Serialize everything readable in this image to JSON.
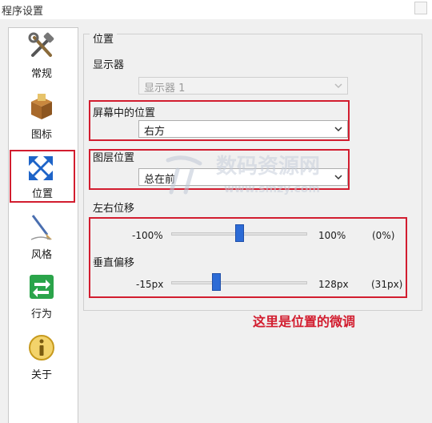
{
  "window": {
    "title": "程序设置"
  },
  "sidebar": {
    "items": [
      {
        "label": "常规",
        "icon": "tools-icon"
      },
      {
        "label": "图标",
        "icon": "package-icon"
      },
      {
        "label": "位置",
        "icon": "move-arrows-icon",
        "selected": true
      },
      {
        "label": "风格",
        "icon": "brush-icon"
      },
      {
        "label": "行为",
        "icon": "exchange-arrows-icon"
      },
      {
        "label": "关于",
        "icon": "info-icon"
      }
    ]
  },
  "position_group": {
    "title": "位置",
    "monitor_label": "显示器",
    "monitor_value": "显示器 1",
    "screen_position_label": "屏幕中的位置",
    "screen_position_value": "右方",
    "layer_label": "图层位置",
    "layer_value": "总在前",
    "horizontal": {
      "label": "左右位移",
      "min": "-100%",
      "max": "100%",
      "current": "(0%)",
      "fraction": 0.5
    },
    "vertical": {
      "label": "垂直偏移",
      "min": "-15px",
      "max": "128px",
      "current": "(31px)",
      "fraction": 0.32
    }
  },
  "annotation": "这里是位置的微调",
  "watermark": {
    "title": "数码资源网",
    "url": "www.smzy.com"
  },
  "colors": {
    "highlight": "#d21d2f",
    "slider_thumb": "#2c6bd6"
  }
}
